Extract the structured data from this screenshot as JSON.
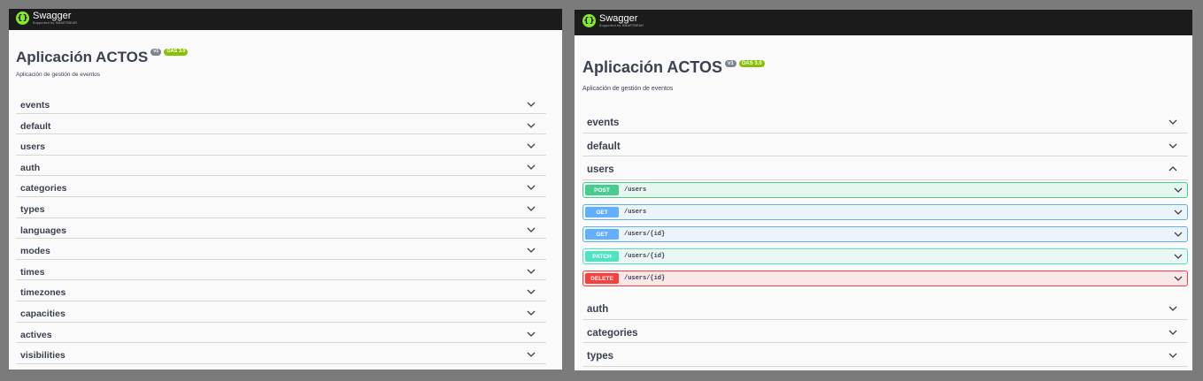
{
  "left": {
    "logo": {
      "name": "Swagger",
      "sub": "Supported by SMARTBEAR"
    },
    "title": "Aplicación ACTOS",
    "version": "v1",
    "oas": "OAS 3.0",
    "description": "Aplicación de gestión de eventos",
    "tags": [
      "events",
      "default",
      "users",
      "auth",
      "categories",
      "types",
      "languages",
      "modes",
      "times",
      "timezones",
      "capacities",
      "actives",
      "visibilities"
    ]
  },
  "right": {
    "logo": {
      "name": "Swagger",
      "sub": "Supported by SMARTBEAR"
    },
    "title": "Aplicación ACTOS",
    "version": "v1",
    "oas": "OAS 3.0",
    "description": "Aplicación de gestión de eventos",
    "tags_before": [
      "events",
      "default"
    ],
    "expanded_tag": "users",
    "operations": [
      {
        "method": "POST",
        "path": "/users"
      },
      {
        "method": "GET",
        "path": "/users"
      },
      {
        "method": "GET",
        "path": "/users/{id}"
      },
      {
        "method": "PATCH",
        "path": "/users/{id}"
      },
      {
        "method": "DELETE",
        "path": "/users/{id}"
      }
    ],
    "tags_after": [
      "auth",
      "categories",
      "types"
    ]
  },
  "colors": {
    "topbar": "#1b1b1b",
    "logo": "#85ea2d",
    "post": "#49cc90",
    "get": "#61affe",
    "patch": "#50e3c2",
    "delete": "#f93e3e"
  }
}
